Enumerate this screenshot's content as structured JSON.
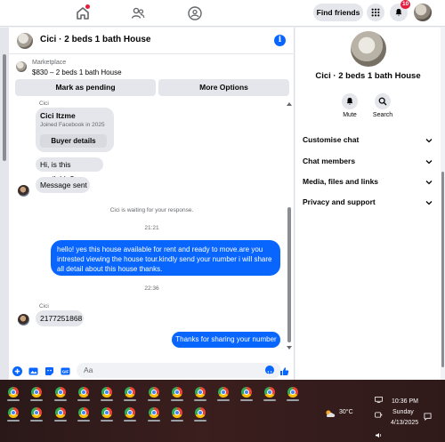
{
  "topnav": {
    "find_friends": "Find friends",
    "notification_count": "10"
  },
  "chat": {
    "title": "Cici · 2 beds 1 bath House",
    "marketplace_label": "Marketplace",
    "listing": "$830 – 2 beds 1 bath House",
    "mark_pending": "Mark as pending",
    "more_options": "More Options",
    "messages": {
      "sender_top": "Cici",
      "profile_name": "Cici Itzme",
      "profile_joined": "Joined Facebook in 2025",
      "buyer_details": "Buyer details",
      "msg1": "Hi, is this available?",
      "msg2": "Message sent",
      "waiting": "Cici is waiting for your response.",
      "time1": "21:21",
      "msg3": "hello! yes this house available for rent and ready to move.are you intrested viewing the house tour.kindly send your number i will share all detail about this house thanks.",
      "time2": "22:36",
      "sender_bottom": "Cici",
      "msg4": "2177251868",
      "msg5": "Thanks for sharing your number"
    },
    "composer_placeholder": "Aa"
  },
  "right_panel": {
    "title": "Cici · 2 beds 1 bath House",
    "mute": "Mute",
    "search": "Search",
    "sections": [
      "Customise chat",
      "Chat members",
      "Media, files and links",
      "Privacy and support"
    ]
  },
  "taskbar": {
    "temperature": "30°C",
    "time": "10:36 PM",
    "day": "Sunday",
    "date": "4/13/2025"
  },
  "colors": {
    "accent": "#0866ff",
    "badge": "#e41e3f"
  }
}
